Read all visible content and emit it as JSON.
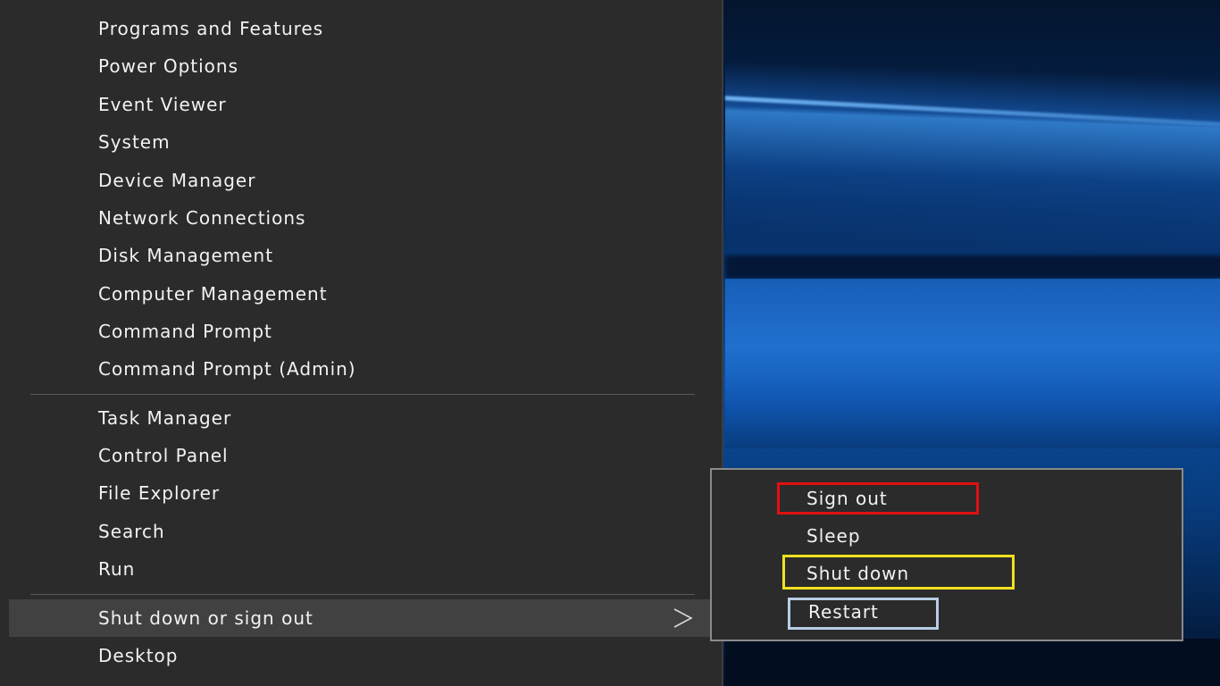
{
  "power_user_menu": {
    "group1": [
      {
        "label": "Programs and Features"
      },
      {
        "label": "Power Options"
      },
      {
        "label": "Event Viewer"
      },
      {
        "label": "System"
      },
      {
        "label": "Device Manager"
      },
      {
        "label": "Network Connections"
      },
      {
        "label": "Disk Management"
      },
      {
        "label": "Computer Management"
      },
      {
        "label": "Command Prompt"
      },
      {
        "label": "Command Prompt (Admin)"
      }
    ],
    "group2": [
      {
        "label": "Task Manager"
      },
      {
        "label": "Control Panel"
      },
      {
        "label": "File Explorer"
      },
      {
        "label": "Search"
      },
      {
        "label": "Run"
      }
    ],
    "shutdown_item": {
      "label": "Shut down or sign out"
    },
    "desktop_item": {
      "label": "Desktop"
    }
  },
  "shutdown_submenu": {
    "items": [
      {
        "label": "Sign out",
        "highlight_color": "#e01010"
      },
      {
        "label": "Sleep"
      },
      {
        "label": "Shut down",
        "highlight_color": "#f0e020"
      },
      {
        "label": "Restart",
        "highlight_color": "#b8cde6"
      }
    ]
  },
  "colors": {
    "menu_background": "#2b2b2b",
    "hover_background": "#414141",
    "text": "#f2f2f2"
  }
}
